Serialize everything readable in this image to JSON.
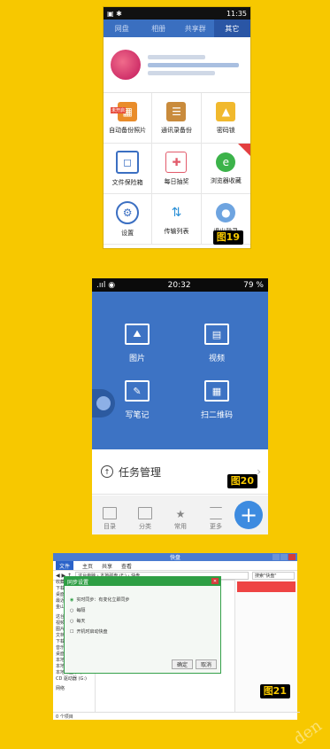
{
  "screen1": {
    "status_time": "11:35",
    "tabs": [
      "网盘",
      "相册",
      "共享群",
      "其它"
    ],
    "active_tab": 3,
    "grid": [
      {
        "label": "自动备份照片",
        "icon": "photo-backup-icon",
        "badge": "未开启"
      },
      {
        "label": "通讯录备份",
        "icon": "contacts-backup-icon"
      },
      {
        "label": "密码锁",
        "icon": "lock-icon"
      },
      {
        "label": "文件保险箱",
        "icon": "safe-box-icon"
      },
      {
        "label": "每日抽奖",
        "icon": "gift-icon"
      },
      {
        "label": "浏览器收藏",
        "icon": "browser-icon"
      },
      {
        "label": "设置",
        "icon": "settings-icon"
      },
      {
        "label": "传输列表",
        "icon": "transfer-icon"
      },
      {
        "label": "退出登录",
        "icon": "logout-icon"
      }
    ],
    "figure": "图19"
  },
  "screen2": {
    "status_time": "20:32",
    "battery": "79 %",
    "items": [
      {
        "label": "图片",
        "icon": "image-icon"
      },
      {
        "label": "视频",
        "icon": "video-icon"
      },
      {
        "label": "写笔记",
        "icon": "note-icon"
      },
      {
        "label": "扫二维码",
        "icon": "qrcode-icon"
      }
    ],
    "task_label": "任务管理",
    "bottom_tabs": [
      "目录",
      "分类",
      "常用",
      "更多"
    ],
    "figure": "图20"
  },
  "screen3": {
    "window_title": "快盘",
    "ribbon": [
      "文件",
      "主页",
      "共享",
      "查看"
    ],
    "path": "这台电脑 › 本地磁盘 (F:) › 快盘",
    "search_placeholder": "搜索\"快盘\"",
    "nav_items": [
      "收藏夹",
      "下载",
      "桌面",
      "最近访问的位置",
      "金山快盘",
      "这台电脑",
      "视频",
      "图片",
      "文档",
      "下载",
      "音乐",
      "桌面",
      "本地磁盘 (C:)",
      "本地磁盘 (E:)",
      "本地磁盘 (F:)",
      "CD 驱动器 (G:)",
      "网络"
    ],
    "dialog_title": "同步设置",
    "dialog_options": [
      "实时同步：有变化立即同步",
      "每隔",
      "每天",
      "开机时启动快盘"
    ],
    "dialog_buttons": [
      "确定",
      "取消"
    ],
    "status_text": "0 个项目",
    "figure": "图21"
  },
  "colors": {
    "background": "#f7c800",
    "accent_blue": "#3d73c4",
    "dialog_green": "#2e9e44"
  }
}
